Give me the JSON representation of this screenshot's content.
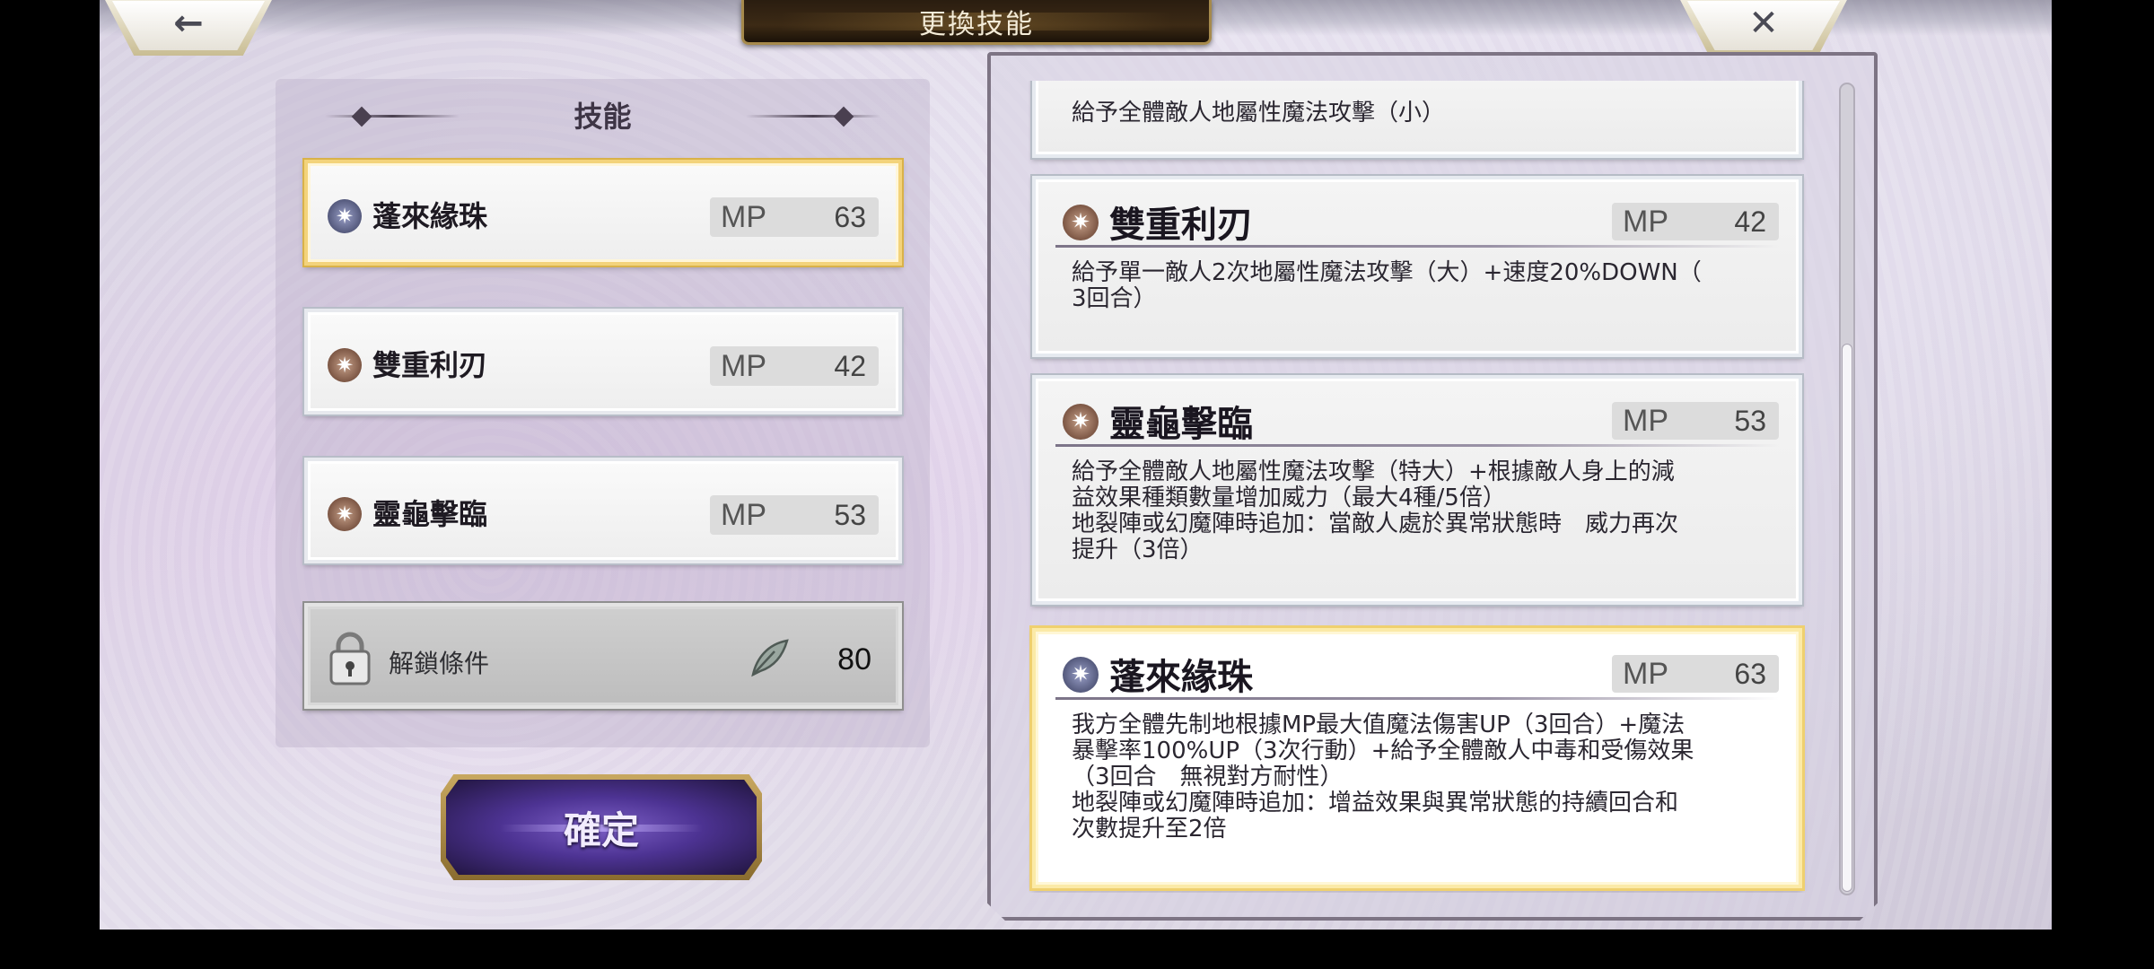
{
  "header": {
    "title": "更換技能",
    "back_icon": "left-arrow-icon",
    "close_icon": "close-icon"
  },
  "left_panel": {
    "title": "技能",
    "skills": [
      {
        "name": "蓬來緣珠",
        "mp_label": "MP",
        "mp": "63",
        "element_icon": "water-element-icon",
        "selected": true
      },
      {
        "name": "雙重利刃",
        "mp_label": "MP",
        "mp": "42",
        "element_icon": "earth-element-icon",
        "selected": false
      },
      {
        "name": "靈龜擊臨",
        "mp_label": "MP",
        "mp": "53",
        "element_icon": "earth-element-icon",
        "selected": false
      }
    ],
    "locked_slot": {
      "label": "解鎖條件",
      "icon": "lock-icon",
      "requirement_icon": "feather-icon",
      "count": "80"
    }
  },
  "confirm_button": {
    "label": "確定"
  },
  "right_panel": {
    "partial_desc": "給予全體敵人地屬性魔法攻擊（小）",
    "cards": [
      {
        "name": "雙重利刃",
        "mp_label": "MP",
        "mp": "42",
        "element_icon": "earth-element-icon",
        "desc": "給予單一敵人2次地屬性魔法攻擊（大）+速度20%DOWN（\n3回合）"
      },
      {
        "name": "靈龜擊臨",
        "mp_label": "MP",
        "mp": "53",
        "element_icon": "earth-element-icon",
        "desc": "給予全體敵人地屬性魔法攻擊（特大）+根據敵人身上的減\n益效果種類數量增加威力（最大4種/5倍）\n地裂陣或幻魔陣時追加：當敵人處於異常狀態時　威力再次\n提升（3倍）"
      },
      {
        "name": "蓬來緣珠",
        "mp_label": "MP",
        "mp": "63",
        "element_icon": "water-element-icon",
        "desc": "我方全體先制地根據MP最大值魔法傷害UP（3回合）+魔法\n暴擊率100%UP（3次行動）+給予全體敵人中毒和受傷效果\n（3回合　無視對方耐性）\n地裂陣或幻魔陣時追加：增益效果與異常狀態的持續回合和\n次數提升至2倍",
        "selected": true
      }
    ],
    "scroll": {
      "thumb_start": 0.32,
      "thumb_end": 1.0
    }
  },
  "colors": {
    "selected_border": "#efd06f",
    "title_plate": "#2a1d10",
    "confirm_button": "#4d3393"
  }
}
